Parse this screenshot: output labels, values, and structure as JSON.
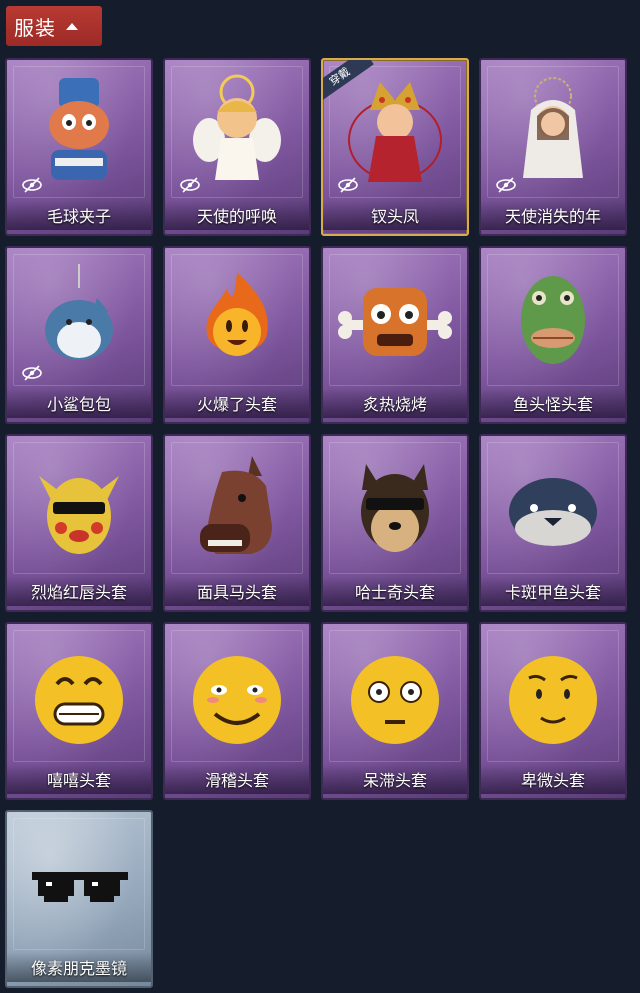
{
  "header": {
    "title": "服装"
  },
  "equipped_badge": "穿戴",
  "items": [
    {
      "label": "毛球夹子",
      "hidden": true
    },
    {
      "label": "天使的呼唤",
      "hidden": true
    },
    {
      "label": "钗头凤",
      "hidden": true,
      "equipped": true
    },
    {
      "label": "天使消失的年",
      "hidden": true
    },
    {
      "label": "小鲨包包",
      "hidden": true
    },
    {
      "label": "火爆了头套"
    },
    {
      "label": "炙热烧烤"
    },
    {
      "label": "鱼头怪头套"
    },
    {
      "label": "烈焰红唇头套"
    },
    {
      "label": "面具马头套"
    },
    {
      "label": "哈士奇头套"
    },
    {
      "label": "卡斑甲鱼头套"
    },
    {
      "label": "嘻嘻头套"
    },
    {
      "label": "滑稽头套"
    },
    {
      "label": "呆滞头套"
    },
    {
      "label": "卑微头套"
    },
    {
      "label": "像素朋克墨镜",
      "plain": true
    }
  ]
}
